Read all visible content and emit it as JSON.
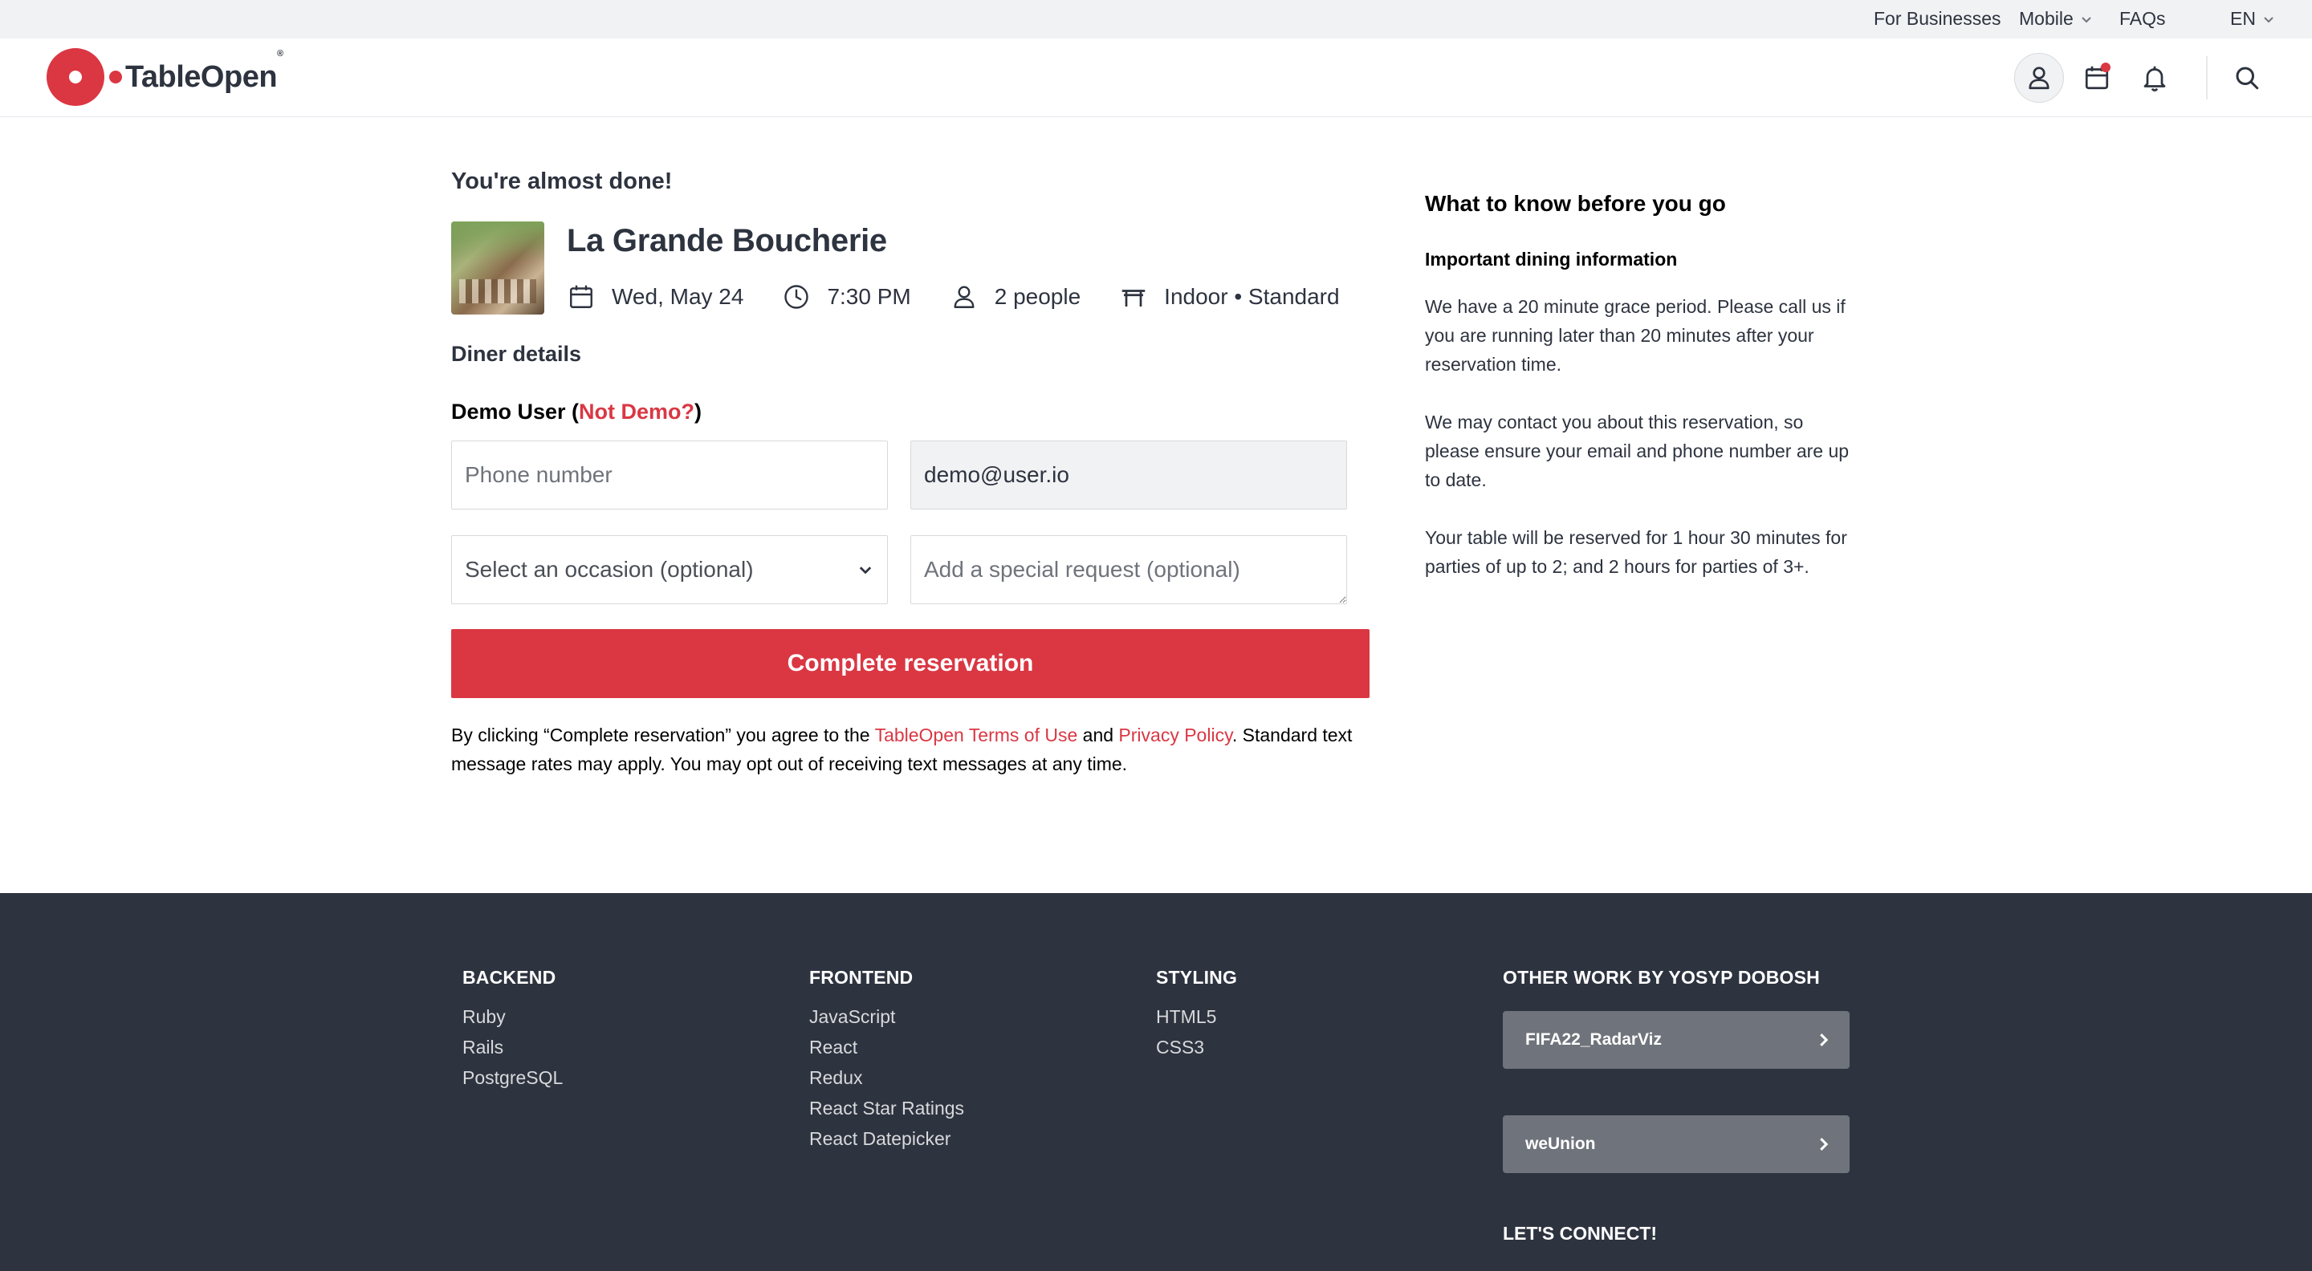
{
  "topbar": {
    "for_businesses": "For Businesses",
    "mobile": "Mobile",
    "faqs": "FAQs",
    "language": "EN"
  },
  "header": {
    "logo_text": "TableOpen",
    "logo_reg": "®",
    "icons": [
      "user-icon",
      "calendar-icon",
      "bell-icon",
      "search-icon"
    ]
  },
  "main": {
    "heading": "You're almost done!",
    "restaurant": {
      "name": "La Grande Boucherie",
      "date": "Wed, May 24",
      "time": "7:30 PM",
      "party": "2 people",
      "seating": "Indoor • Standard"
    },
    "diner_details_label": "Diner details",
    "user": {
      "name_prefix": "Demo User (",
      "not_demo": "Not Demo?",
      "name_suffix": ")"
    },
    "form": {
      "phone_placeholder": "Phone number",
      "email_value": "demo@user.io",
      "occasion_value": "Select an occasion (optional)",
      "request_placeholder": "Add a special request (optional)"
    },
    "cta_label": "Complete reservation",
    "terms": {
      "part1": "By clicking “Complete reservation” you agree to the ",
      "terms_link": "TableOpen Terms of Use",
      "part2": " and ",
      "privacy_link": "Privacy Policy",
      "part3": ". Standard text message rates may apply. You may opt out of receiving text messages at any time."
    }
  },
  "sidebar": {
    "title": "What to know before you go",
    "subtitle": "Important dining information",
    "paragraphs": [
      "We have a 20 minute grace period. Please call us if you are running later than 20 minutes after your reservation time.",
      "We may contact you about this reservation, so please ensure your email and phone number are up to date.",
      "Your table will be reserved for 1 hour 30 minutes for parties of up to 2; and 2 hours for parties of 3+."
    ]
  },
  "footer": {
    "backend": {
      "heading": "BACKEND",
      "items": [
        "Ruby",
        "Rails",
        "PostgreSQL"
      ]
    },
    "frontend": {
      "heading": "FRONTEND",
      "items": [
        "JavaScript",
        "React",
        "Redux",
        "React Star Ratings",
        "React Datepicker"
      ]
    },
    "styling": {
      "heading": "STYLING",
      "items": [
        "HTML5",
        "CSS3"
      ]
    },
    "other": {
      "heading": "OTHER WORK BY YOSYP DOBOSH",
      "buttons": [
        "FIFA22_RadarViz",
        "weUnion"
      ]
    },
    "connect_heading": "LET'S CONNECT!"
  },
  "colors": {
    "brand": "#da3743",
    "text": "#2d333f",
    "footer_bg": "#2d333f",
    "topbar_bg": "#f1f2f4"
  }
}
